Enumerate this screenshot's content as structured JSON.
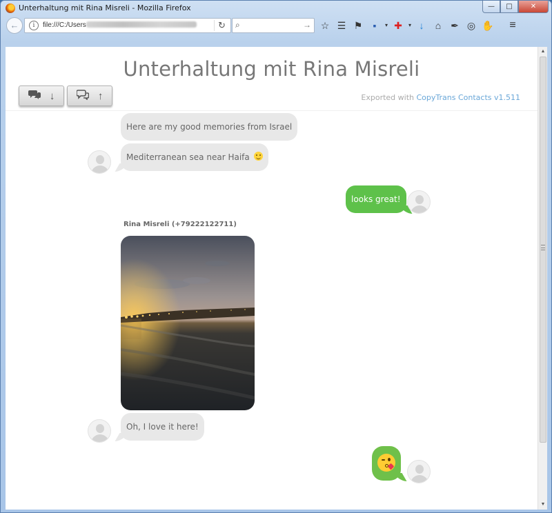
{
  "window": {
    "title": "Unterhaltung mit Rina Misreli - Mozilla Firefox",
    "minimize": "—",
    "maximize": "□",
    "close": "✕"
  },
  "navbar": {
    "back_icon": "←",
    "info_icon": "i",
    "url_prefix": "file:///C:/Users",
    "reload_icon": "↻",
    "search_placeholder": "",
    "search_icon": "⌕",
    "search_go_icon": "→",
    "icons": {
      "bookmark_star": "☆",
      "reading_list": "☰",
      "pocket": "⚑",
      "save": "▪",
      "dropdown_a": "▾",
      "addon_red": "✚",
      "dropdown_b": "▾",
      "downloads": "↓",
      "home": "⌂",
      "addon_a": "✒",
      "addon_b": "◎",
      "addon_c": "✋",
      "menu": "≡"
    }
  },
  "page": {
    "title": "Unterhaltung mit Rina Misreli",
    "sort_buttons": [
      {
        "icon": "chat-bubbles-icon",
        "arrow": "↓"
      },
      {
        "icon": "chat-bubbles-outline-icon",
        "arrow": "↑"
      }
    ],
    "exported_prefix": "Exported with ",
    "exported_link": "CopyTrans Contacts v1.511"
  },
  "messages": [
    {
      "direction": "in",
      "text": "Here are my good memories from Israel"
    },
    {
      "direction": "in",
      "text": "Mediterranean sea near Haifa",
      "emoji": "slightly-smiling-face"
    },
    {
      "direction": "out",
      "text": "looks great!"
    },
    {
      "direction": "in",
      "sender": "Rina Misreli (+79222122711)",
      "attachment": "photo-sea-at-night"
    },
    {
      "direction": "in",
      "text": "Oh, I love it here!"
    },
    {
      "direction": "out",
      "emoji": "face-blowing-a-kiss"
    }
  ],
  "colors": {
    "incoming_bubble": "#e8e8e8",
    "outgoing_bubble": "#5ec14a",
    "link": "#6aa7d8",
    "title_text": "#777777"
  }
}
